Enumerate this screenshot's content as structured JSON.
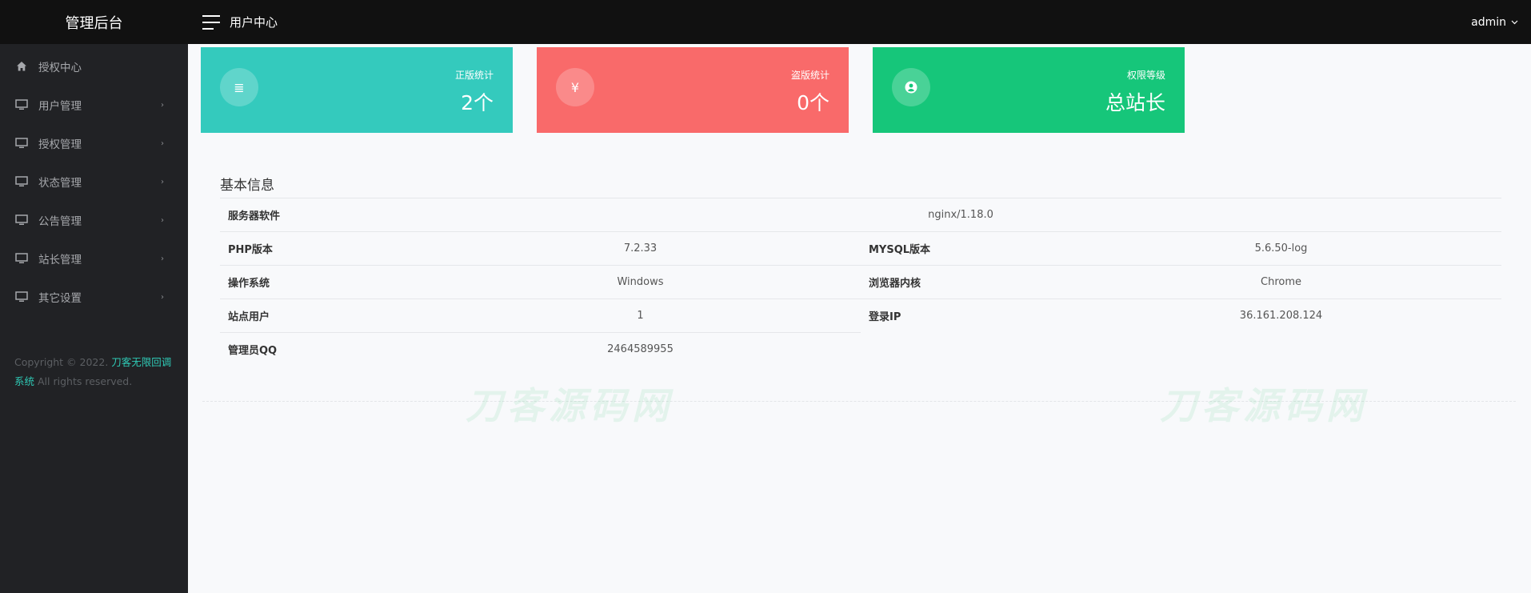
{
  "brand": {
    "title": "管理后台"
  },
  "topbar": {
    "title": "用户中心",
    "user": "admin"
  },
  "sidebar": {
    "items": [
      {
        "label": "授权中心",
        "icon": "home-icon",
        "has_arrow": false
      },
      {
        "label": "用户管理",
        "icon": "monitor-icon",
        "has_arrow": true
      },
      {
        "label": "授权管理",
        "icon": "monitor-icon",
        "has_arrow": true
      },
      {
        "label": "状态管理",
        "icon": "monitor-icon",
        "has_arrow": true
      },
      {
        "label": "公告管理",
        "icon": "monitor-icon",
        "has_arrow": true
      },
      {
        "label": "站长管理",
        "icon": "monitor-icon",
        "has_arrow": true
      },
      {
        "label": "其它设置",
        "icon": "monitor-icon",
        "has_arrow": true
      }
    ],
    "arrow_glyph": "›",
    "copyright": {
      "prefix": "Copyright © 2022.",
      "brand": "刀客无限回调系统",
      "suffix": "All rights reserved."
    }
  },
  "cards": [
    {
      "label": "正版统计",
      "value": "2个",
      "icon": "list-icon",
      "icon_glyph": "≣",
      "color": "#34cabd"
    },
    {
      "label": "盗版统计",
      "value": "0个",
      "icon": "yen-icon",
      "icon_glyph": "¥",
      "color": "#f96a6a"
    },
    {
      "label": "权限等级",
      "value": "总站长",
      "icon": "user-circle-icon",
      "icon_glyph": "",
      "color": "#16c67a"
    }
  ],
  "info": {
    "title": "基本信息",
    "server_software": {
      "label": "服务器软件",
      "value": "nginx/1.18.0"
    },
    "php": {
      "label": "PHP版本",
      "value": "7.2.33"
    },
    "mysql": {
      "label": "MYSQL版本",
      "value": "5.6.50-log"
    },
    "os": {
      "label": "操作系统",
      "value": "Windows"
    },
    "browser": {
      "label": "浏览器内核",
      "value": "Chrome"
    },
    "site_users": {
      "label": "站点用户",
      "value": "1"
    },
    "login_ip": {
      "label": "登录IP",
      "value": "36.161.208.124"
    },
    "admin_qq": {
      "label": "管理员QQ",
      "value": "2464589955"
    }
  },
  "watermark": {
    "text": "刀客源码网"
  }
}
